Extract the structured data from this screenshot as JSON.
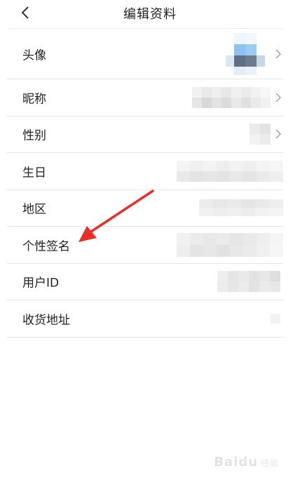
{
  "header": {
    "title": "编辑资料",
    "back_icon": "back-chevron-icon"
  },
  "rows": [
    {
      "label": "头像",
      "has_chevron": true
    },
    {
      "label": "昵称",
      "has_chevron": true
    },
    {
      "label": "性别",
      "has_chevron": true
    },
    {
      "label": "生日",
      "has_chevron": false
    },
    {
      "label": "地区",
      "has_chevron": false
    },
    {
      "label": "个性签名",
      "has_chevron": false
    },
    {
      "label": "用户ID",
      "has_chevron": false
    },
    {
      "label": "收货地址",
      "has_chevron": false
    }
  ],
  "annotation": {
    "color": "#e8302a"
  },
  "watermark": {
    "text": "Baidu",
    "sub": "经验"
  },
  "colors": {
    "divider": "#e6e6e6",
    "label": "#222222",
    "avatar_blue": "#7fb8ec",
    "avatar_dark": "#5e6f86",
    "blur_gray": "#e2e2e2"
  }
}
